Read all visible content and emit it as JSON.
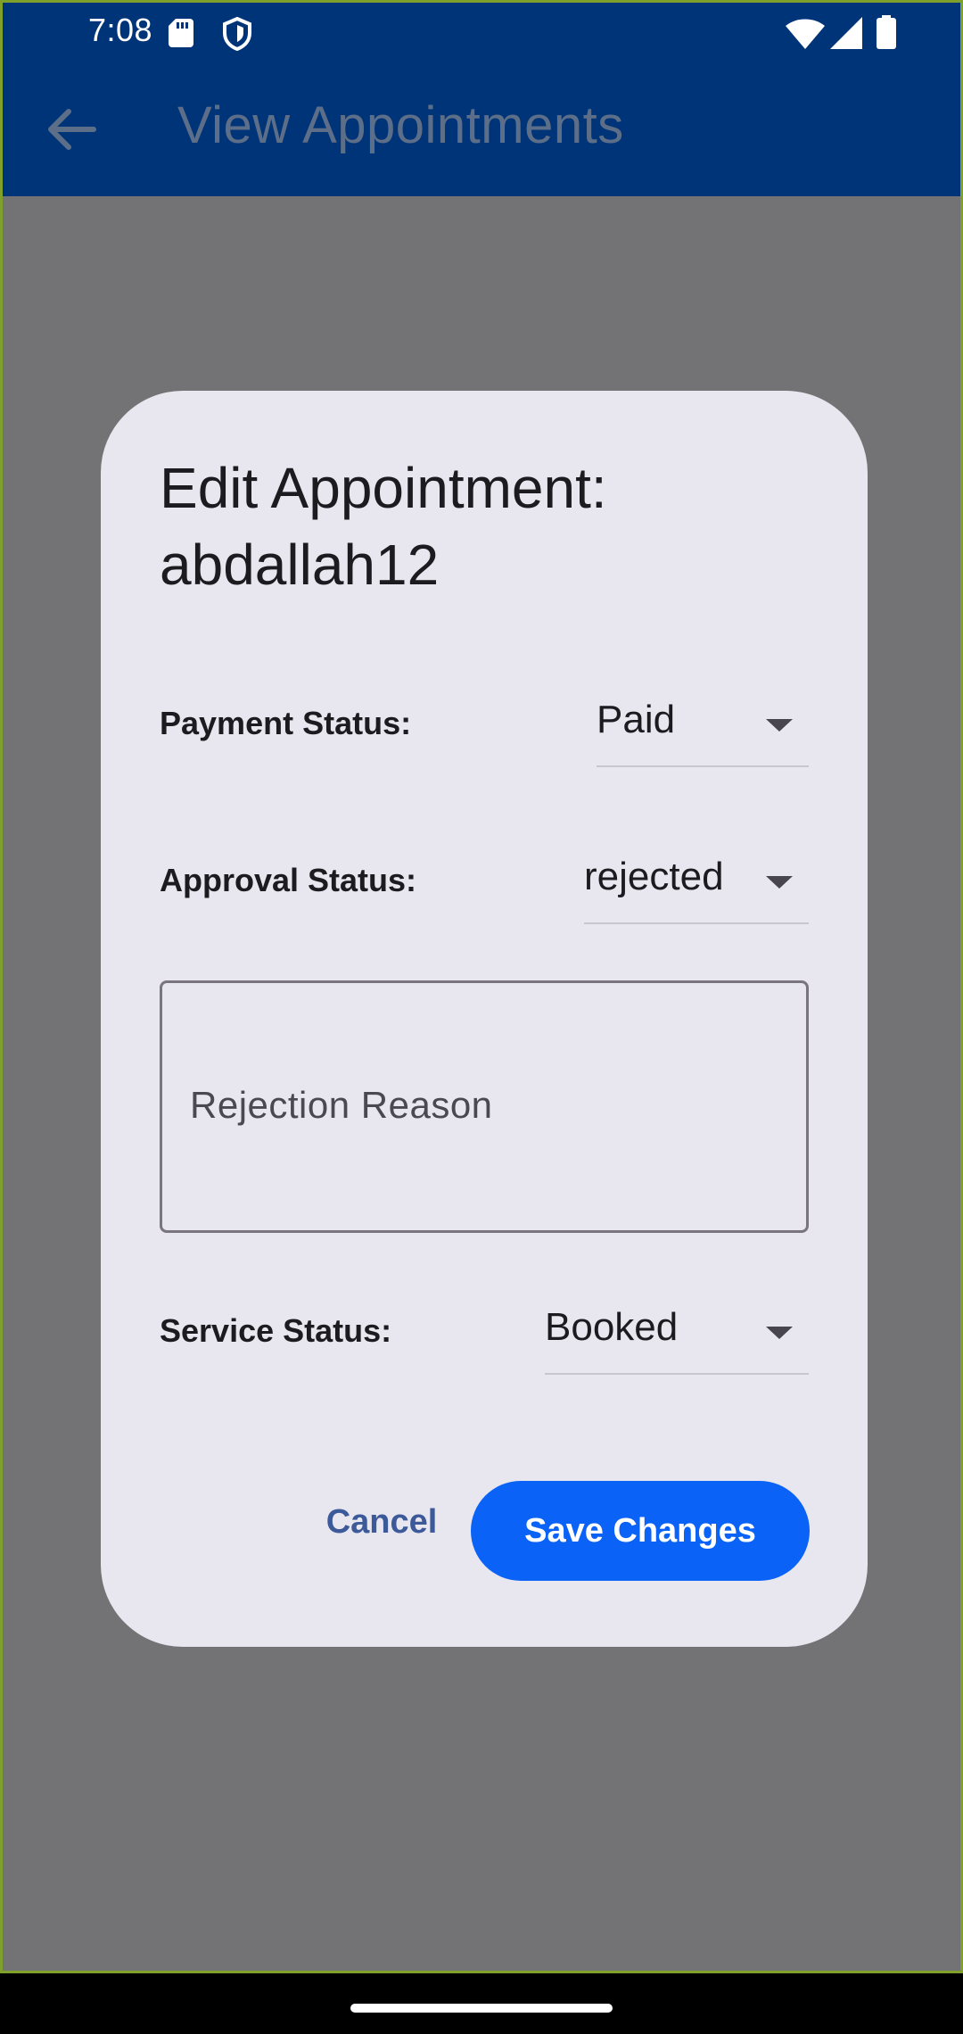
{
  "status_bar": {
    "time": "7:08",
    "icons": [
      "sd-card-icon",
      "shield-icon",
      "wifi-icon",
      "signal-icon",
      "battery-icon"
    ]
  },
  "appbar": {
    "title": "View Appointments",
    "back_icon": "arrow-back-icon"
  },
  "dialog": {
    "title": "Edit Appointment: abdallah12",
    "payment": {
      "label": "Payment Status:",
      "value": "Paid"
    },
    "approval": {
      "label": "Approval Status:",
      "value": "rejected"
    },
    "rejection_reason": {
      "placeholder": "Rejection Reason",
      "value": ""
    },
    "service": {
      "label": "Service Status:",
      "value": "Booked"
    },
    "cancel_label": "Cancel",
    "save_label": "Save Changes"
  },
  "colors": {
    "appbar": "#003478",
    "scrim": "#737375",
    "dialog_bg": "#e8e6ee",
    "primary_button": "#0a63f6",
    "cancel_text": "#3c5a99"
  }
}
